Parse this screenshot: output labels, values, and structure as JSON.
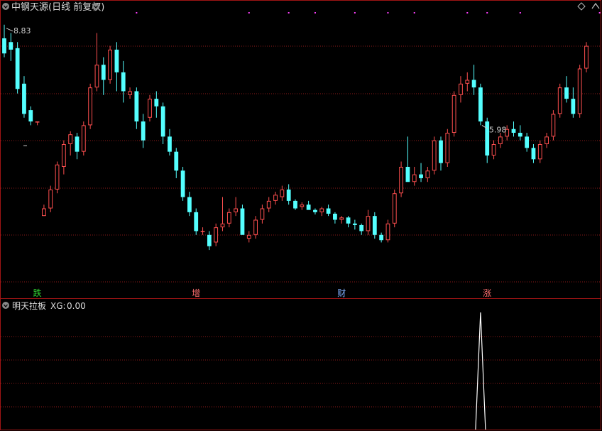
{
  "title": "中钢天源(日线 前复权)",
  "indicator": {
    "name": "明天拉板",
    "label": "XG:",
    "value": "0.00"
  },
  "colors": {
    "up": "#ff4f4f",
    "down": "#54ffff",
    "grid": "#8b1a1a",
    "panel_border": "#a01414",
    "signal": "#ffffff",
    "dots": "#ff40ff"
  },
  "icons": {
    "title_toggle": "chevron-circle-icon",
    "indicator_toggle": "chevron-circle-icon",
    "corner_diamond": "diamond-icon",
    "corner_arrow": "arrow-up-icon"
  },
  "chart_data": {
    "type": "candlestick",
    "ylim": [
      5.4,
      8.95
    ],
    "high_marker": {
      "index": 0,
      "value": "8.83"
    },
    "low_marker": {
      "index": 72,
      "value": "5.98"
    },
    "candles": [
      {
        "o": 8.65,
        "h": 8.83,
        "l": 8.4,
        "c": 8.45
      },
      {
        "o": 8.6,
        "h": 8.72,
        "l": 8.35,
        "c": 8.5
      },
      {
        "o": 8.52,
        "h": 8.6,
        "l": 7.92,
        "c": 7.98
      },
      {
        "o": 8.05,
        "h": 8.15,
        "l": 7.6,
        "c": 7.65
      },
      {
        "o": 7.7,
        "h": 7.75,
        "l": 7.5,
        "c": 7.55
      },
      {
        "o": 7.55,
        "h": 7.55,
        "l": 7.5,
        "c": 7.55
      },
      {
        "o": 6.3,
        "h": 6.45,
        "l": 6.3,
        "c": 6.4
      },
      {
        "o": 6.4,
        "h": 6.7,
        "l": 6.35,
        "c": 6.65
      },
      {
        "o": 6.65,
        "h": 7.02,
        "l": 6.6,
        "c": 6.98
      },
      {
        "o": 6.95,
        "h": 7.3,
        "l": 6.85,
        "c": 7.25
      },
      {
        "o": 7.25,
        "h": 7.42,
        "l": 7.1,
        "c": 7.38
      },
      {
        "o": 7.35,
        "h": 7.4,
        "l": 7.05,
        "c": 7.15
      },
      {
        "o": 7.15,
        "h": 7.55,
        "l": 7.1,
        "c": 7.5
      },
      {
        "o": 7.5,
        "h": 8.05,
        "l": 7.45,
        "c": 8.0
      },
      {
        "o": 8.0,
        "h": 8.72,
        "l": 7.95,
        "c": 8.3
      },
      {
        "o": 8.3,
        "h": 8.4,
        "l": 7.9,
        "c": 8.1
      },
      {
        "o": 8.1,
        "h": 8.55,
        "l": 8.05,
        "c": 8.5
      },
      {
        "o": 8.5,
        "h": 8.6,
        "l": 7.95,
        "c": 8.2
      },
      {
        "o": 8.2,
        "h": 8.35,
        "l": 7.8,
        "c": 7.95
      },
      {
        "o": 7.9,
        "h": 8.0,
        "l": 7.85,
        "c": 7.95
      },
      {
        "o": 7.95,
        "h": 8.0,
        "l": 7.45,
        "c": 7.55
      },
      {
        "o": 7.55,
        "h": 7.65,
        "l": 7.2,
        "c": 7.3
      },
      {
        "o": 7.6,
        "h": 7.9,
        "l": 7.55,
        "c": 7.85
      },
      {
        "o": 7.85,
        "h": 7.95,
        "l": 7.6,
        "c": 7.75
      },
      {
        "o": 7.75,
        "h": 7.8,
        "l": 7.25,
        "c": 7.35
      },
      {
        "o": 7.35,
        "h": 7.45,
        "l": 7.1,
        "c": 7.15
      },
      {
        "o": 7.15,
        "h": 7.2,
        "l": 6.8,
        "c": 6.9
      },
      {
        "o": 6.9,
        "h": 6.95,
        "l": 6.5,
        "c": 6.55
      },
      {
        "o": 6.55,
        "h": 6.62,
        "l": 6.3,
        "c": 6.35
      },
      {
        "o": 6.35,
        "h": 6.4,
        "l": 6.05,
        "c": 6.1
      },
      {
        "o": 6.1,
        "h": 6.15,
        "l": 6.05,
        "c": 6.1
      },
      {
        "o": 6.05,
        "h": 6.1,
        "l": 5.85,
        "c": 5.9
      },
      {
        "o": 5.95,
        "h": 6.2,
        "l": 5.9,
        "c": 6.15
      },
      {
        "o": 6.15,
        "h": 6.55,
        "l": 6.1,
        "c": 6.2
      },
      {
        "o": 6.2,
        "h": 6.4,
        "l": 6.15,
        "c": 6.35
      },
      {
        "o": 6.35,
        "h": 6.55,
        "l": 6.3,
        "c": 6.4
      },
      {
        "o": 6.4,
        "h": 6.45,
        "l": 6.1,
        "c": 6.05
      },
      {
        "o": 6.0,
        "h": 6.1,
        "l": 5.95,
        "c": 6.05
      },
      {
        "o": 6.05,
        "h": 6.3,
        "l": 6.0,
        "c": 6.25
      },
      {
        "o": 6.25,
        "h": 6.45,
        "l": 6.2,
        "c": 6.4
      },
      {
        "o": 6.4,
        "h": 6.55,
        "l": 6.35,
        "c": 6.5
      },
      {
        "o": 6.5,
        "h": 6.62,
        "l": 6.45,
        "c": 6.58
      },
      {
        "o": 6.55,
        "h": 6.7,
        "l": 6.5,
        "c": 6.65
      },
      {
        "o": 6.65,
        "h": 6.72,
        "l": 6.45,
        "c": 6.5
      },
      {
        "o": 6.5,
        "h": 6.52,
        "l": 6.38,
        "c": 6.4
      },
      {
        "o": 6.42,
        "h": 6.48,
        "l": 6.38,
        "c": 6.45
      },
      {
        "o": 6.45,
        "h": 6.5,
        "l": 6.4,
        "c": 6.38
      },
      {
        "o": 6.38,
        "h": 6.4,
        "l": 6.32,
        "c": 6.35
      },
      {
        "o": 6.35,
        "h": 6.42,
        "l": 6.3,
        "c": 6.4
      },
      {
        "o": 6.4,
        "h": 6.45,
        "l": 6.3,
        "c": 6.33
      },
      {
        "o": 6.33,
        "h": 6.35,
        "l": 6.2,
        "c": 6.25
      },
      {
        "o": 6.25,
        "h": 6.3,
        "l": 6.2,
        "c": 6.28
      },
      {
        "o": 6.28,
        "h": 6.3,
        "l": 6.15,
        "c": 6.2
      },
      {
        "o": 6.2,
        "h": 6.25,
        "l": 6.12,
        "c": 6.18
      },
      {
        "o": 6.18,
        "h": 6.2,
        "l": 6.05,
        "c": 6.1
      },
      {
        "o": 6.1,
        "h": 6.38,
        "l": 6.05,
        "c": 6.3
      },
      {
        "o": 6.3,
        "h": 6.35,
        "l": 6.0,
        "c": 6.05
      },
      {
        "o": 6.05,
        "h": 6.08,
        "l": 5.95,
        "c": 5.98
      },
      {
        "o": 5.98,
        "h": 6.25,
        "l": 5.95,
        "c": 6.2
      },
      {
        "o": 6.2,
        "h": 6.65,
        "l": 6.15,
        "c": 6.6
      },
      {
        "o": 6.6,
        "h": 7.02,
        "l": 6.55,
        "c": 6.95
      },
      {
        "o": 6.95,
        "h": 7.35,
        "l": 6.9,
        "c": 6.75
      },
      {
        "o": 6.75,
        "h": 6.95,
        "l": 6.7,
        "c": 6.85
      },
      {
        "o": 6.85,
        "h": 7.0,
        "l": 6.75,
        "c": 6.8
      },
      {
        "o": 6.8,
        "h": 6.95,
        "l": 6.75,
        "c": 6.9
      },
      {
        "o": 6.9,
        "h": 7.35,
        "l": 6.85,
        "c": 7.3
      },
      {
        "o": 7.3,
        "h": 7.35,
        "l": 6.9,
        "c": 7.0
      },
      {
        "o": 7.0,
        "h": 7.45,
        "l": 6.95,
        "c": 7.4
      },
      {
        "o": 7.4,
        "h": 7.95,
        "l": 7.35,
        "c": 7.9
      },
      {
        "o": 7.9,
        "h": 8.15,
        "l": 7.8,
        "c": 8.05
      },
      {
        "o": 8.05,
        "h": 8.2,
        "l": 7.95,
        "c": 8.1
      },
      {
        "o": 8.1,
        "h": 8.3,
        "l": 7.9,
        "c": 8.0
      },
      {
        "o": 8.0,
        "h": 8.05,
        "l": 7.5,
        "c": 7.55
      },
      {
        "o": 7.55,
        "h": 7.6,
        "l": 7.0,
        "c": 7.1
      },
      {
        "o": 7.1,
        "h": 7.3,
        "l": 7.05,
        "c": 7.25
      },
      {
        "o": 7.25,
        "h": 7.4,
        "l": 7.2,
        "c": 7.35
      },
      {
        "o": 7.35,
        "h": 7.5,
        "l": 7.3,
        "c": 7.45
      },
      {
        "o": 7.45,
        "h": 7.55,
        "l": 7.35,
        "c": 7.4
      },
      {
        "o": 7.4,
        "h": 7.5,
        "l": 7.3,
        "c": 7.35
      },
      {
        "o": 7.35,
        "h": 7.4,
        "l": 7.15,
        "c": 7.2
      },
      {
        "o": 7.2,
        "h": 7.25,
        "l": 7.0,
        "c": 7.05
      },
      {
        "o": 7.05,
        "h": 7.3,
        "l": 7.0,
        "c": 7.25
      },
      {
        "o": 7.25,
        "h": 7.4,
        "l": 7.2,
        "c": 7.35
      },
      {
        "o": 7.35,
        "h": 7.7,
        "l": 7.3,
        "c": 7.65
      },
      {
        "o": 7.65,
        "h": 8.05,
        "l": 7.6,
        "c": 8.0
      },
      {
        "o": 8.0,
        "h": 8.15,
        "l": 7.8,
        "c": 7.85
      },
      {
        "o": 7.85,
        "h": 8.0,
        "l": 7.6,
        "c": 7.65
      },
      {
        "o": 7.65,
        "h": 8.3,
        "l": 7.6,
        "c": 8.25
      },
      {
        "o": 8.25,
        "h": 8.6,
        "l": 8.2,
        "c": 8.55
      }
    ],
    "signal_index": 72,
    "y_markers": [
      {
        "index": 1,
        "value": 7.5
      }
    ],
    "tag_labels": [
      {
        "index": 5,
        "text": "跌",
        "color": "#30d030"
      },
      {
        "index": 29,
        "text": "增",
        "color": "#ff7070"
      },
      {
        "index": 51,
        "text": "财",
        "color": "#7fb0ff"
      },
      {
        "index": 73,
        "text": "涨",
        "color": "#ff7070"
      },
      {
        "index": 100,
        "text": "$",
        "color": "#ff4040"
      }
    ],
    "top_dots": [
      20,
      37,
      43,
      47,
      53,
      58,
      62,
      70,
      73,
      78,
      90,
      103,
      106
    ]
  }
}
